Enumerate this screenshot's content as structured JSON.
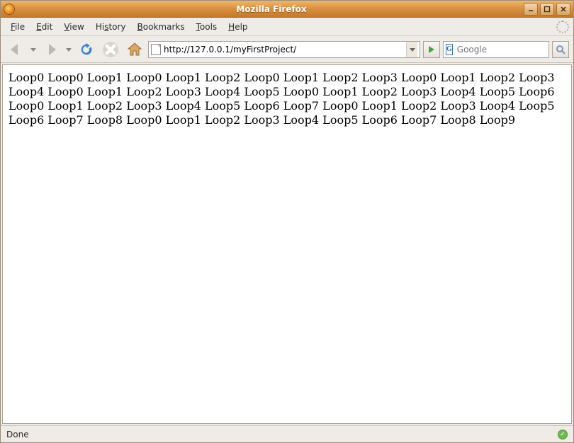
{
  "window": {
    "title": "Mozilla Firefox"
  },
  "menu": {
    "file": "File",
    "edit": "Edit",
    "view": "View",
    "history": "History",
    "bookmarks": "Bookmarks",
    "tools": "Tools",
    "help": "Help"
  },
  "toolbar": {
    "url": "http://127.0.0.1/myFirstProject/",
    "search_placeholder": "Google",
    "search_engine": "G"
  },
  "content": {
    "words": [
      "Loop0",
      "Loop0",
      "Loop1",
      "Loop0",
      "Loop1",
      "Loop2",
      "Loop0",
      "Loop1",
      "Loop2",
      "Loop3",
      "Loop0",
      "Loop1",
      "Loop2",
      "Loop3",
      "Loop4",
      "Loop0",
      "Loop1",
      "Loop2",
      "Loop3",
      "Loop4",
      "Loop5",
      "Loop0",
      "Loop1",
      "Loop2",
      "Loop3",
      "Loop4",
      "Loop5",
      "Loop6",
      "Loop0",
      "Loop1",
      "Loop2",
      "Loop3",
      "Loop4",
      "Loop5",
      "Loop6",
      "Loop7",
      "Loop0",
      "Loop1",
      "Loop2",
      "Loop3",
      "Loop4",
      "Loop5",
      "Loop6",
      "Loop7",
      "Loop8",
      "Loop0",
      "Loop1",
      "Loop2",
      "Loop3",
      "Loop4",
      "Loop5",
      "Loop6",
      "Loop7",
      "Loop8",
      "Loop9"
    ]
  },
  "status": {
    "text": "Done"
  }
}
